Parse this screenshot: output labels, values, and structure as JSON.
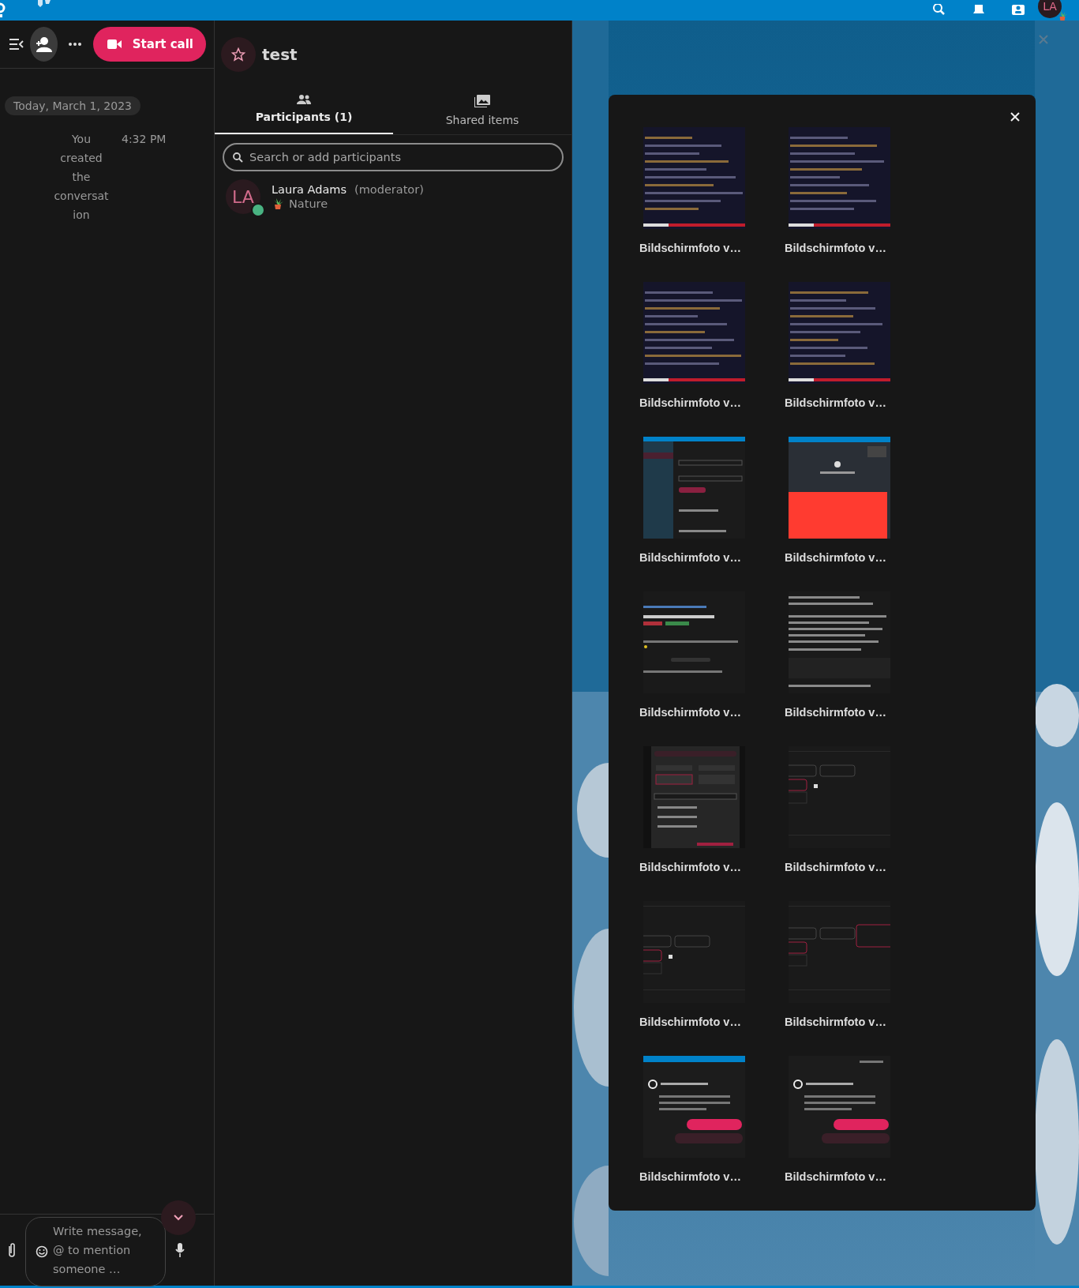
{
  "top_bar": {
    "avatar": {
      "initials": "LA"
    }
  },
  "conversation": {
    "start_call": "Start call",
    "date": "Today, March 1, 2023",
    "messages": [
      {
        "text": "You created the conversation",
        "time": "4:32 PM"
      }
    ],
    "composer": {
      "placeholder": "Write message, @ to mention someone …"
    }
  },
  "sidebar": {
    "title": "test",
    "tabs": [
      {
        "label": "Participants (1)",
        "selected": true
      },
      {
        "label": "Shared items",
        "selected": false
      }
    ],
    "search": {
      "placeholder": "Search or add participants"
    },
    "participants": [
      {
        "initials": "LA",
        "name": "Laura Adams",
        "role": "(moderator)",
        "status": "Nature",
        "online": true
      }
    ]
  },
  "viewer": {
    "items": [
      {
        "label": "Bildschirmfoto v…"
      },
      {
        "label": "Bildschirmfoto v…"
      },
      {
        "label": "Bildschirmfoto v…"
      },
      {
        "label": "Bildschirmfoto v…"
      },
      {
        "label": "Bildschirmfoto v…"
      },
      {
        "label": "Bildschirmfoto v…"
      },
      {
        "label": "Bildschirmfoto v…"
      },
      {
        "label": "Bildschirmfoto v…"
      },
      {
        "label": "Bildschirmfoto v…"
      },
      {
        "label": "Bildschirmfoto v…"
      },
      {
        "label": "Bildschirmfoto v…"
      },
      {
        "label": "Bildschirmfoto v…"
      },
      {
        "label": "Bildschirmfoto v…"
      },
      {
        "label": "Bildschirmfoto v…"
      }
    ]
  }
}
